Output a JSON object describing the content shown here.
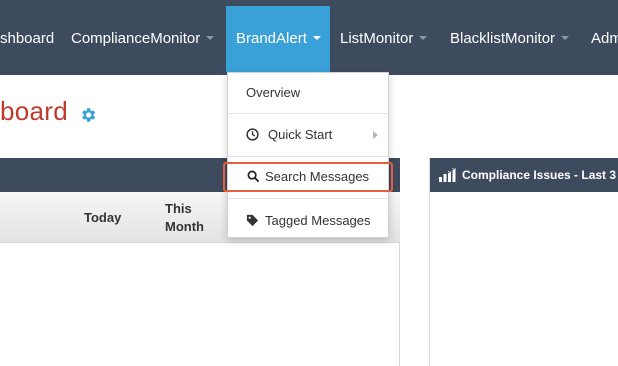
{
  "nav": {
    "items": [
      {
        "label": "shboard"
      },
      {
        "label": "ComplianceMonitor"
      },
      {
        "label": "BrandAlert"
      },
      {
        "label": "ListMonitor"
      },
      {
        "label": "BlacklistMonitor"
      },
      {
        "label": "Adm"
      }
    ]
  },
  "page": {
    "title": "board"
  },
  "table": {
    "columns": [
      "Today",
      "This\nMonth"
    ]
  },
  "right_panel": {
    "title": "Compliance Issues - Last 3"
  },
  "dropdown": {
    "items": [
      {
        "label": "Overview"
      },
      {
        "label": "Quick Start"
      },
      {
        "label": "Search Messages"
      },
      {
        "label": "Tagged Messages"
      }
    ]
  },
  "colors": {
    "nav_bg": "#3e4a5e",
    "active": "#3aa0d8",
    "title": "#c0392b",
    "highlight": "#e8603f"
  }
}
